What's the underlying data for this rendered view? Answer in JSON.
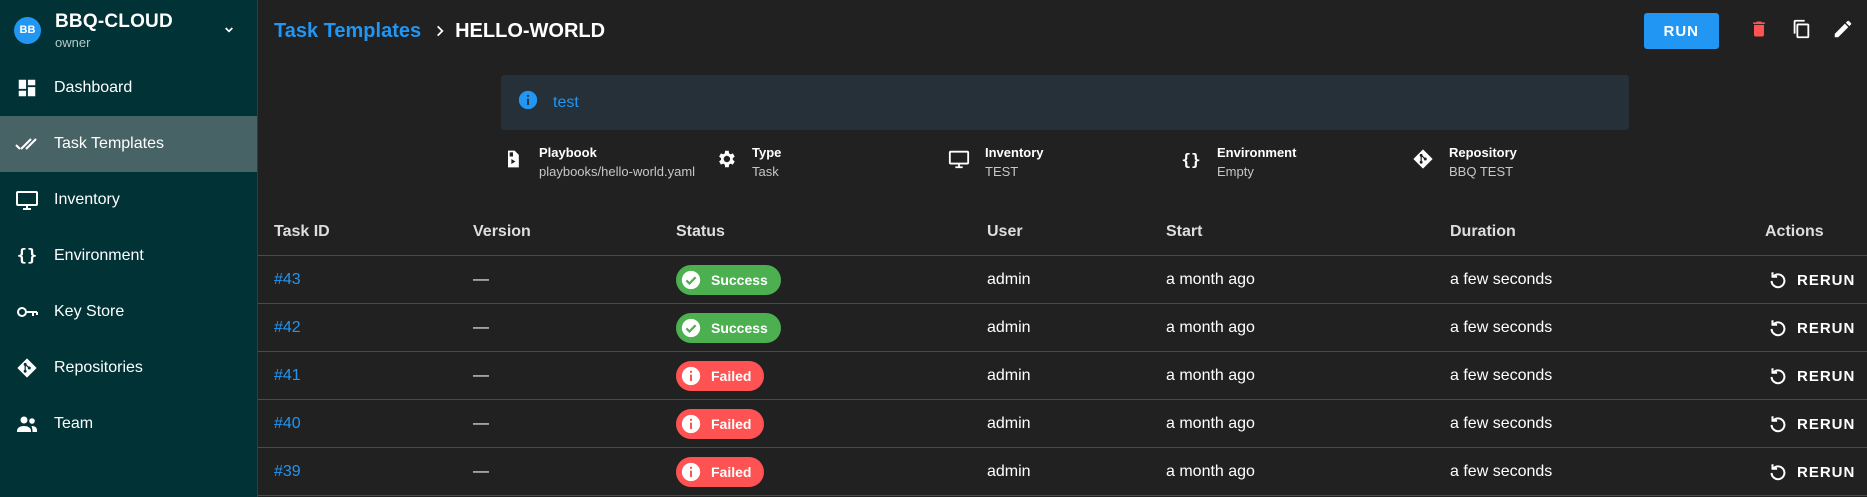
{
  "project": {
    "avatar": "BB",
    "name": "BBQ-CLOUD",
    "role": "owner"
  },
  "nav": [
    {
      "label": "Dashboard",
      "icon": "dashboard-icon"
    },
    {
      "label": "Task Templates",
      "icon": "double-check-icon"
    },
    {
      "label": "Inventory",
      "icon": "monitor-icon"
    },
    {
      "label": "Environment",
      "icon": "braces-icon"
    },
    {
      "label": "Key Store",
      "icon": "key-icon"
    },
    {
      "label": "Repositories",
      "icon": "git-icon"
    },
    {
      "label": "Team",
      "icon": "team-icon"
    }
  ],
  "breadcrumb": {
    "parent": "Task Templates",
    "current": "HELLO-WORLD"
  },
  "actions": {
    "run": "RUN"
  },
  "alert": {
    "text": "test"
  },
  "meta": [
    {
      "title": "Playbook",
      "value": "playbooks/hello-world.yaml",
      "icon": "playbook-icon"
    },
    {
      "title": "Type",
      "value": "Task",
      "icon": "gear-icon"
    },
    {
      "title": "Inventory",
      "value": "TEST",
      "icon": "monitor-icon"
    },
    {
      "title": "Environment",
      "value": "Empty",
      "icon": "braces-icon"
    },
    {
      "title": "Repository",
      "value": "BBQ TEST",
      "icon": "git-icon"
    }
  ],
  "table": {
    "headers": {
      "id": "Task ID",
      "version": "Version",
      "status": "Status",
      "user": "User",
      "start": "Start",
      "duration": "Duration",
      "actions": "Actions"
    },
    "rows": [
      {
        "id": "#43",
        "version": "—",
        "status": "Success",
        "user": "admin",
        "start": "a month ago",
        "duration": "a few seconds",
        "action": "RERUN"
      },
      {
        "id": "#42",
        "version": "—",
        "status": "Success",
        "user": "admin",
        "start": "a month ago",
        "duration": "a few seconds",
        "action": "RERUN"
      },
      {
        "id": "#41",
        "version": "—",
        "status": "Failed",
        "user": "admin",
        "start": "a month ago",
        "duration": "a few seconds",
        "action": "RERUN"
      },
      {
        "id": "#40",
        "version": "—",
        "status": "Failed",
        "user": "admin",
        "start": "a month ago",
        "duration": "a few seconds",
        "action": "RERUN"
      },
      {
        "id": "#39",
        "version": "—",
        "status": "Failed",
        "user": "admin",
        "start": "a month ago",
        "duration": "a few seconds",
        "action": "RERUN"
      }
    ]
  },
  "colors": {
    "accent": "#2196f3",
    "success": "#4caf50",
    "failed": "#ff5252",
    "sidebar": "#003236",
    "danger": "#ff5252"
  }
}
